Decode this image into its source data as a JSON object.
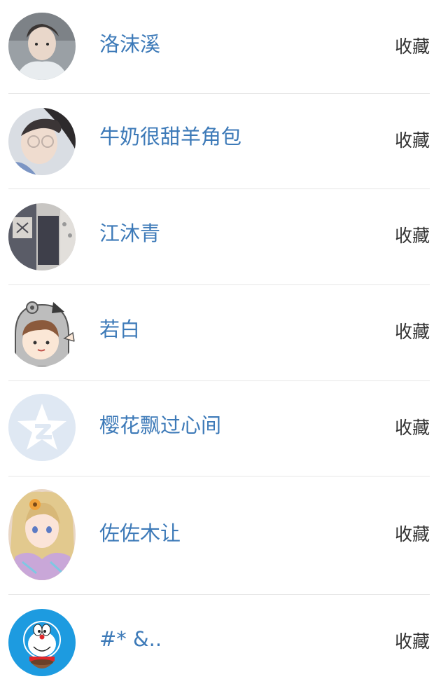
{
  "theme": {
    "name_color": "#3d7ab8",
    "action_color": "#333333",
    "divider_color": "#e6e6e6"
  },
  "users": [
    {
      "name": "洛沫溪",
      "action": "收藏",
      "avatar_icon": "photo-avatar"
    },
    {
      "name": "牛奶很甜羊角包",
      "action": "收藏",
      "avatar_icon": "photo-avatar-glasses"
    },
    {
      "name": "江沐青",
      "action": "收藏",
      "avatar_icon": "photo-avatar-room"
    },
    {
      "name": "若白",
      "action": "收藏",
      "avatar_icon": "cartoon-boy-avatar"
    },
    {
      "name": "樱花飘过心间",
      "action": "收藏",
      "avatar_icon": "qzone-star-default-avatar"
    },
    {
      "name": "佐佐木让",
      "action": "收藏",
      "avatar_icon": "anime-girl-avatar"
    },
    {
      "name": "#* &..",
      "action": "收藏",
      "avatar_icon": "doraemon-avatar"
    }
  ]
}
